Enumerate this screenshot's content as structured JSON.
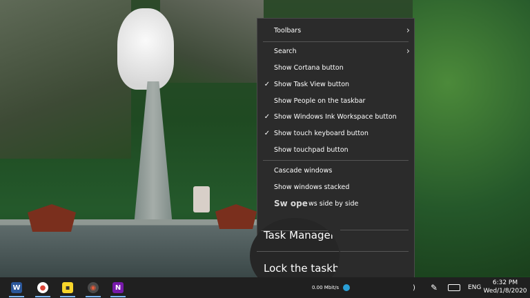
{
  "context_menu": {
    "items": [
      {
        "label": "Toolbars",
        "checked": false,
        "has_submenu": true
      },
      {
        "label": "Search",
        "checked": false,
        "has_submenu": true
      },
      {
        "label": "Show Cortana button",
        "checked": false,
        "has_submenu": false
      },
      {
        "label": "Show Task View button",
        "checked": true,
        "has_submenu": false
      },
      {
        "label": "Show People on the taskbar",
        "checked": false,
        "has_submenu": false
      },
      {
        "label": "Show Windows Ink Workspace button",
        "checked": true,
        "has_submenu": false
      },
      {
        "label": "Show touch keyboard button",
        "checked": true,
        "has_submenu": false
      },
      {
        "label": "Show touchpad button",
        "checked": false,
        "has_submenu": false
      },
      {
        "label": "Cascade windows",
        "checked": false,
        "has_submenu": false
      },
      {
        "label": "Show windows stacked",
        "checked": false,
        "has_submenu": false
      }
    ],
    "partial_label": "Sw ope",
    "partial_label_suffix": "ws side by side",
    "magnified": {
      "task_manager": "Task Manager",
      "lock_taskbar": "Lock the taskbar"
    },
    "check_glyph": "✓",
    "submenu_glyph": "›"
  },
  "taskbar": {
    "apps": [
      {
        "name": "word-icon",
        "glyph": "W",
        "color": "#2b579a"
      },
      {
        "name": "chrome-icon",
        "glyph": "●",
        "color": "#db4437"
      },
      {
        "name": "sticky-notes-icon",
        "glyph": "▪",
        "color": "#f7d52b"
      },
      {
        "name": "app-ring-icon",
        "glyph": "◉",
        "color": "#4a4a4a"
      },
      {
        "name": "onenote-icon",
        "glyph": "N",
        "color": "#7719aa"
      }
    ],
    "network_speed": "0.00 Mbit/s",
    "language": "ENG",
    "time": "6:32 PM",
    "date": "Wed/1/8/2020"
  }
}
